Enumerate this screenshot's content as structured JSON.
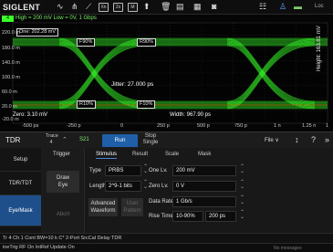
{
  "app": {
    "brand": "SIGLENT",
    "top_right": "Loc"
  },
  "toolbar": {
    "icons": [
      "waveform-icon",
      "marker-icon",
      "ruler-icon",
      "zoom-icon",
      "measure-icon",
      "trash-icon",
      "save-icon",
      "print-icon",
      "camera-icon"
    ],
    "badges": [
      "Xn",
      "2x",
      "M",
      "I/O",
      "AA"
    ]
  },
  "plot": {
    "trace_header": "High = 200 mV  Low = 0V, 1 Gbps",
    "one_label": "One: 202.28 mV",
    "y_ticks": [
      "220.0 m",
      "180.0 m",
      "140.0 m",
      "100.0 m",
      "60.0 m",
      "20.0 m",
      "-20.0 m"
    ],
    "x_ticks": [
      "-500 ps",
      "-250 p",
      "0",
      "250 p",
      "500 p",
      "750 p",
      "1 n",
      "1.25 n",
      "1"
    ],
    "f90": "F90%",
    "r90": "R90%",
    "r10": "R10%",
    "f10": "F10%",
    "jitter": "Jitter: 27.000 ps",
    "zero": "Zero: 3.10 mV",
    "width": "Width: 967.90 ps",
    "height": "Height: 163.81 mV",
    "trace_color": "#39ff2a"
  },
  "tdr": {
    "title": "TDR",
    "trace_label": "Trace",
    "trace_num": "4",
    "sparam": "S21",
    "run": "Run",
    "stop_line1": "Stop",
    "stop_line2": "Single",
    "file": "File",
    "file_chevron": "∨"
  },
  "nav": [
    "Setup",
    "TDR/TDT",
    "Eye/Mask"
  ],
  "trigger": {
    "label": "Trigger",
    "draw_eye_1": "Draw",
    "draw_eye_2": "Eye",
    "abort": "Abort"
  },
  "tabs": [
    "Stimulus",
    "Result",
    "Scale",
    "Mask"
  ],
  "stimulus": {
    "type_label": "Type",
    "type_value": "PRBS",
    "one_level_label": "One Lv.",
    "one_level_value": "200 mV",
    "length_label": "Length",
    "length_value": "2^9-1 bits",
    "zero_level_label": "Zero Lv.",
    "zero_level_value": "0 V",
    "adv_1": "Advanced",
    "adv_2": "Waveform",
    "user_1": "User",
    "user_2": "Pattern",
    "data_rate_label": "Data Rate",
    "data_rate_value": "1 Gb/s",
    "rise_time_label": "Rise Time",
    "rise_time_mode": "10-90%",
    "rise_time_value": "200 ps"
  },
  "status": {
    "text": "Tr 4   Ch 1    Cont    BW=10 k   C* 2-Port   SrcCal   Delay   TDR",
    "text2": "ineTrig  RF On  IntRef  Update On",
    "nomsg": "No messages"
  }
}
